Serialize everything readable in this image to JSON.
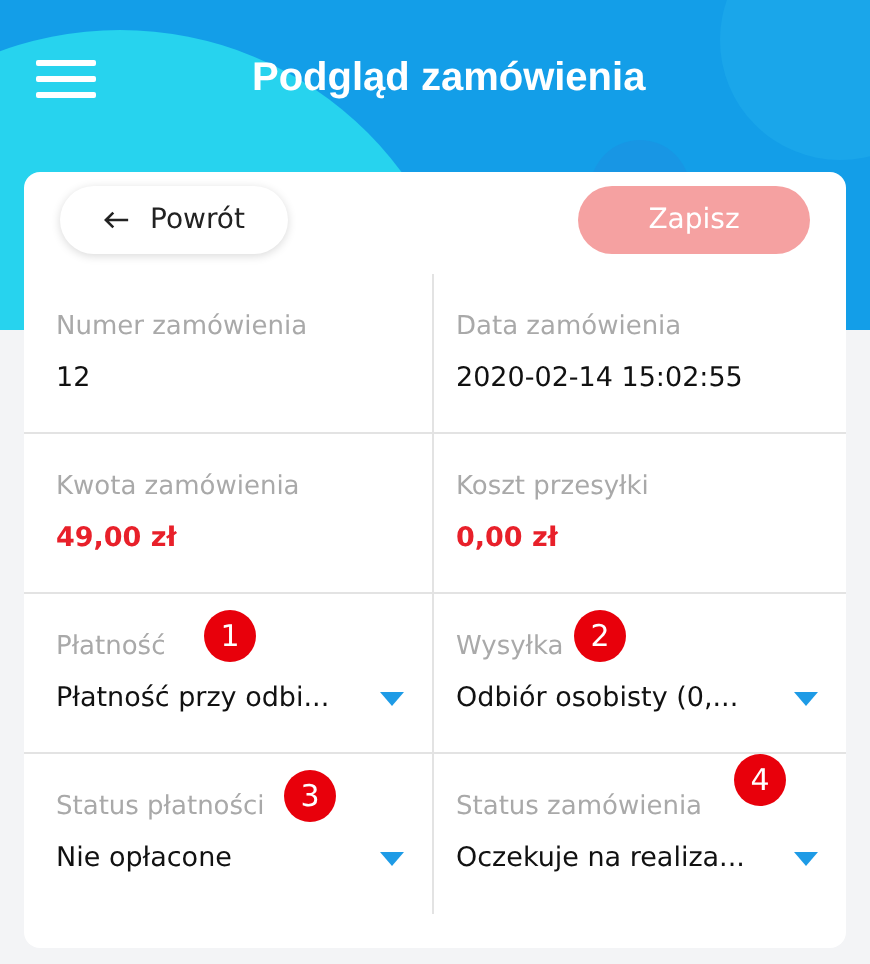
{
  "header": {
    "title": "Podgląd zamówienia"
  },
  "back_button": {
    "label": "Powrót"
  },
  "save_button": {
    "label": "Zapisz",
    "disabled": true
  },
  "fields": [
    {
      "kind": "text",
      "label": "Numer zamówienia",
      "value": "12"
    },
    {
      "kind": "text",
      "label": "Data zamówienia",
      "value": "2020-02-14  15:02:55"
    },
    {
      "kind": "amount",
      "label": "Kwota zamówienia",
      "value": "49,00 zł"
    },
    {
      "kind": "amount",
      "label": "Koszt przesyłki",
      "value": "0,00 zł"
    },
    {
      "kind": "select",
      "label": "Płatność",
      "value": "Płatność przy odbi...",
      "badge": "1"
    },
    {
      "kind": "select",
      "label": "Wysyłka",
      "value": "Odbiór osobisty (0,...",
      "badge": "2"
    },
    {
      "kind": "select",
      "label": "Status płatności",
      "value": "Nie opłacone",
      "badge": "3"
    },
    {
      "kind": "select",
      "label": "Status zamówienia",
      "value": "Oczekuje na realiza...",
      "badge": "4"
    }
  ]
}
